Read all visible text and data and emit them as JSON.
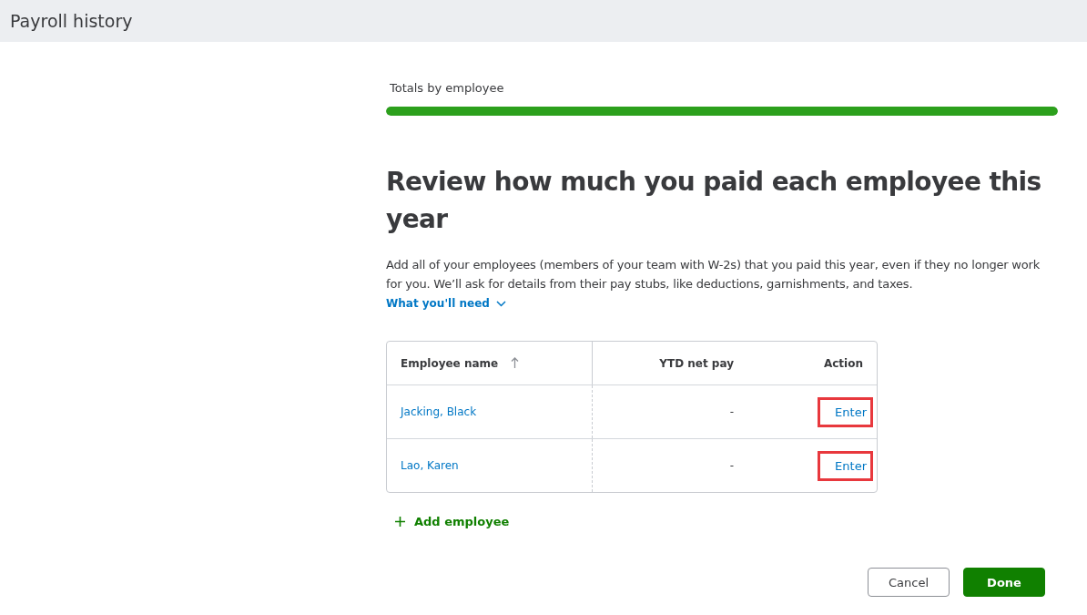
{
  "header": {
    "title": "Payroll history"
  },
  "progress": {
    "label": "Totals by employee",
    "level": 1
  },
  "heading": "Review how much you paid each employee this year",
  "description": "Add all of your employees (members of your team with W-2s) that you paid this year, even if they no longer work for you. We’ll ask for details from their pay stubs, like deductions, garnishments, and taxes.",
  "expander": {
    "label": "What you'll need",
    "expanded": false
  },
  "table": {
    "columns": [
      {
        "label": "Employee name",
        "sorted": true
      },
      {
        "label": "YTD net pay"
      },
      {
        "label": "Action"
      }
    ],
    "rows": [
      {
        "name": "Jacking, Black",
        "ytd_net_pay": "-",
        "action": "Enter",
        "highlighted": true
      },
      {
        "name": "Lao, Karen",
        "ytd_net_pay": "-",
        "action": "Enter",
        "highlighted": true
      }
    ]
  },
  "add_button": {
    "label": "Add employee"
  },
  "buttons": [
    {
      "label": "Cancel",
      "kind": "secondary"
    },
    {
      "label": "Done",
      "kind": "primary"
    }
  ]
}
